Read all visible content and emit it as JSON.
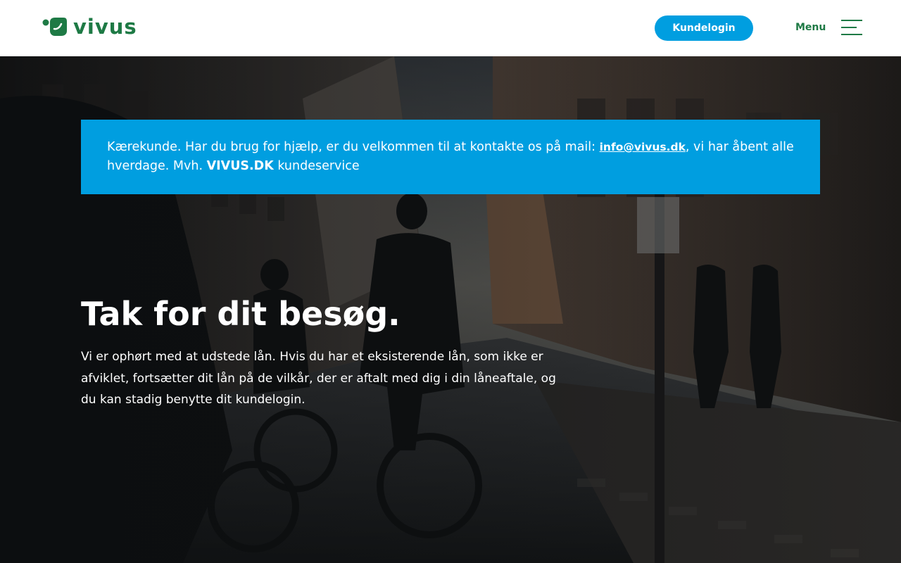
{
  "header": {
    "logo_text": "vivus",
    "login_label": "Kundelogin",
    "menu_label": "Menu",
    "brand_color": "#1e7a45",
    "accent_color": "#009ee0"
  },
  "notice": {
    "text_before": "Kærekunde. Har du brug for hjælp, er du velkommen til at kontakte os på mail: ",
    "email": "info@vivus.dk",
    "text_middle": ", vi har åbent alle hverdage. Mvh. ",
    "brand": "VIVUS.DK",
    "text_after": " kundeservice"
  },
  "hero": {
    "title": "Tak for dit besøg.",
    "body": "Vi er ophørt med at udstede lån. Hvis du har et eksisterende lån, som ikke er afviklet, fortsætter dit lån på de vilkår, der er aftalt med dig i din  låneaftale, og du kan stadig benytte dit kundelogin.",
    "background_image": "city-street-cyclists-photo"
  }
}
